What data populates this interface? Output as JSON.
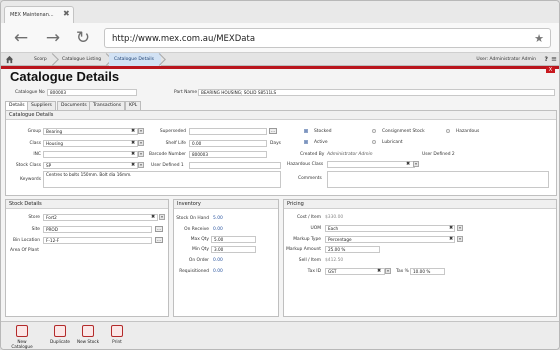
{
  "browser": {
    "tab_title": "MEX Maintenan...",
    "close_glyph": "✖",
    "url": "http://www.mex.com.au/MEXData",
    "back_glyph": "←",
    "forward_glyph": "→",
    "reload_glyph": "↻",
    "star_glyph": "★"
  },
  "breadcrumbs": [
    "Scorp",
    "Catalogue Listing",
    "Catalogue Details"
  ],
  "user": {
    "text": "User: Administrator Admin",
    "help": "?",
    "menu": "≡"
  },
  "page": {
    "title": "Catalogue Details",
    "close_glyph": "X"
  },
  "header": {
    "catalogue_no_label": "Catalogue No",
    "catalogue_no": "800003",
    "part_name_label": "Part Name",
    "part_name": "BEARING HOUSING; SOLID S8511LS"
  },
  "tabs": [
    "Details",
    "Suppliers",
    "Documents",
    "Transactions",
    "KPL"
  ],
  "catalogue_panel": {
    "title": "Catalogue Details",
    "group_label": "Group",
    "group": "Bearing",
    "class_label": "Class",
    "class": "Housing",
    "inc_label": "INC",
    "inc": "",
    "stock_class_label": "Stock Class",
    "stock_class": "SP",
    "keywords_label": "Keywords",
    "keywords": "Centres to bolts 150mm.  Bolt dia 16mm.",
    "superseded_label": "Superseded",
    "superseded": "",
    "shelf_life_label": "Shelf Life",
    "shelf_life": "0.00",
    "shelf_life_unit": "Days",
    "barcode_label": "Barcode Number",
    "barcode": "800003",
    "user_defined1_label": "User Defined 1",
    "user_defined1": "",
    "stocked_label": "Stocked",
    "consignment_label": "Consignment Stock",
    "hazardous_label": "Hazardous",
    "active_label": "Active",
    "lubricant_label": "Lubricant",
    "created_by_label": "Created By",
    "created_by": "Administrator Admin",
    "user_defined2_label": "User Defined 2",
    "hazardous_class_label": "Hazardous Class",
    "hazardous_class": "",
    "comments_label": "Comments",
    "comments": ""
  },
  "stock_panel": {
    "title": "Stock Details",
    "store_label": "Store",
    "store": "Fort2",
    "site_label": "Site",
    "site": "PROD",
    "bin_label": "Bin Location",
    "bin": "F-12-F",
    "area_label": "Area Of Plant",
    "area": ""
  },
  "inventory_panel": {
    "title": "Inventory",
    "stock_on_hand_label": "Stock On Hand",
    "stock_on_hand": "5.00",
    "on_receive_label": "On Receive",
    "on_receive": "0.00",
    "max_qty_label": "Max Qty",
    "max_qty": "5.00",
    "min_qty_label": "Min Qty",
    "min_qty": "3.00",
    "on_order_label": "On Order",
    "on_order": "0.00",
    "requisitioned_label": "Requisitioned",
    "requisitioned": "0.00"
  },
  "pricing_panel": {
    "title": "Pricing",
    "cost_label": "Cost / Item",
    "cost": "$330.00",
    "uom_label": "UOM",
    "uom": "Each",
    "markup_type_label": "Markup Type",
    "markup_type": "Percentage",
    "markup_amount_label": "Markup Amount",
    "markup_amount": "25.00 %",
    "sell_label": "Sell / Item",
    "sell": "$412.50",
    "tax_id_label": "Tax ID",
    "tax_id": "GST",
    "tax_pct_label": "Tax %",
    "tax_pct": "10.00 %"
  },
  "bottom_buttons": [
    "New Catalogue",
    "Duplicate",
    "New Stock",
    "Print"
  ],
  "icons": {
    "dropdown_clear": "✖",
    "dropdown_arrow": "▾",
    "lookup": "..."
  },
  "colors": {
    "accent": "#b9151d",
    "tab_active": "#d2e2f4",
    "checkbox": "#7b93c0"
  }
}
